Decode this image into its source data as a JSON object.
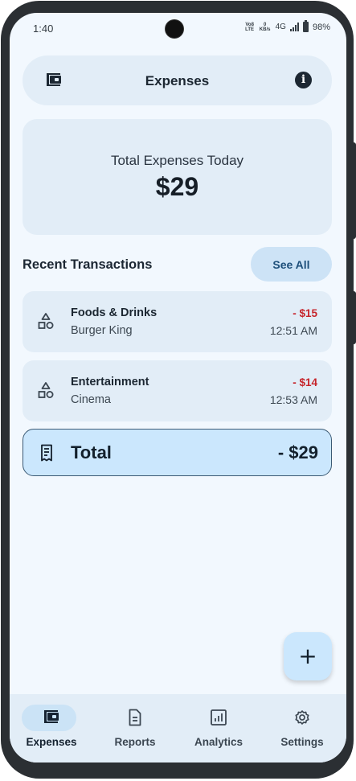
{
  "status": {
    "time": "1:40",
    "volte": "Vo8 LTE",
    "speed": "0 KB/s",
    "network": "4G",
    "battery": "98%"
  },
  "header": {
    "title": "Expenses",
    "left_icon": "wallet-icon",
    "right_icon": "info-icon",
    "info_glyph": "i"
  },
  "summary": {
    "label": "Total Expenses Today",
    "amount": "$29"
  },
  "recent": {
    "title": "Recent Transactions",
    "see_all": "See All"
  },
  "transactions": [
    {
      "category": "Foods & Drinks",
      "merchant": "Burger King",
      "amount": "- $15",
      "time": "12:51 AM",
      "icon": "category-shapes-icon"
    },
    {
      "category": "Entertainment",
      "merchant": "Cinema",
      "amount": "- $14",
      "time": "12:53 AM",
      "icon": "category-shapes-icon"
    }
  ],
  "total": {
    "label": "Total",
    "amount": "- $29",
    "icon": "receipt-icon"
  },
  "fab": {
    "label": "+",
    "icon": "plus-icon"
  },
  "nav": [
    {
      "label": "Expenses",
      "icon": "wallet-icon",
      "active": true
    },
    {
      "label": "Reports",
      "icon": "document-icon",
      "active": false
    },
    {
      "label": "Analytics",
      "icon": "bar-chart-icon",
      "active": false
    },
    {
      "label": "Settings",
      "icon": "gear-icon",
      "active": false
    }
  ],
  "colors": {
    "background": "#f2f8fe",
    "card": "#e2edf7",
    "accent": "#cbe7fd",
    "negative": "#c6242b"
  }
}
